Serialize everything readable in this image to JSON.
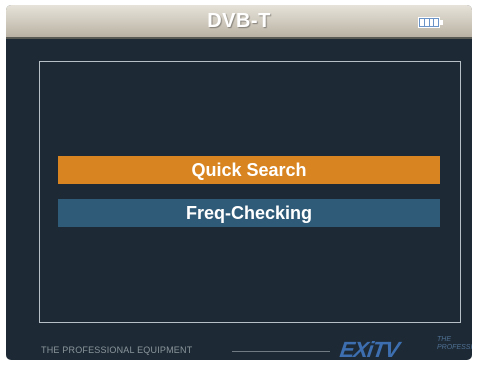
{
  "header": {
    "title": "DVB-T",
    "battery_icon": "battery-full-icon"
  },
  "menu": {
    "items": [
      {
        "label": "Quick Search",
        "selected": true
      },
      {
        "label": "Freq-Checking",
        "selected": false
      }
    ]
  },
  "footer": {
    "tagline": "THE PROFESSIONAL EQUIPMENT",
    "logo_text": "EXiTV",
    "logo_small_text": "THE PROFESSIONAL"
  },
  "colors": {
    "background": "#1d2a35",
    "selected_item": "#d88420",
    "normal_item": "#2f5b78",
    "title_bar": "#cfc9bd",
    "logo": "#3d6fb0"
  }
}
